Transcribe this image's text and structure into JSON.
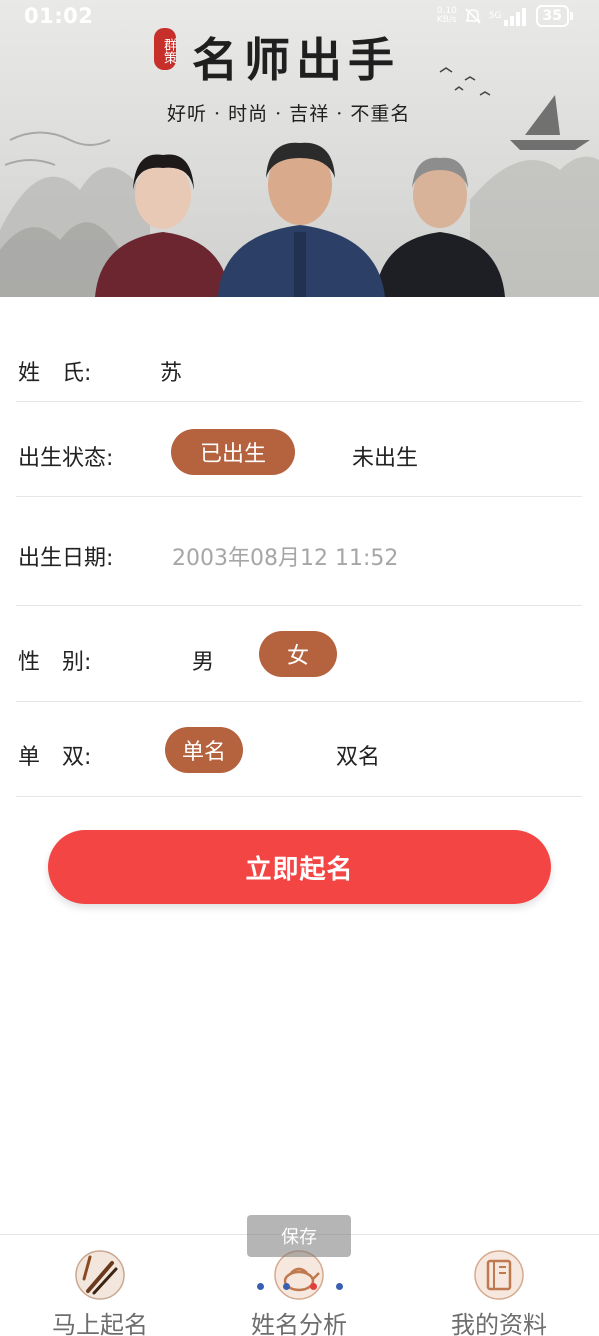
{
  "status_bar": {
    "time": "01:02",
    "net_speed_value": "0.10",
    "net_speed_unit": "KB/s",
    "network_type": "5G",
    "battery": "35"
  },
  "banner": {
    "seal_text": "群策",
    "title": "名师出手",
    "subtitle": "好听 · 时尚 · 吉祥 · 不重名"
  },
  "form": {
    "surname": {
      "label": "姓　氏:",
      "value": "苏"
    },
    "birth_status": {
      "label": "出生状态:",
      "options": [
        "已出生",
        "未出生"
      ],
      "selected": "已出生"
    },
    "birth_date": {
      "label": "出生日期:",
      "value": "2003年08月12 11:52"
    },
    "gender": {
      "label": "性　别:",
      "options": [
        "男",
        "女"
      ],
      "selected": "女"
    },
    "name_length": {
      "label": "单　双:",
      "options": [
        "单名",
        "双名"
      ],
      "selected": "单名"
    }
  },
  "submit_label": "立即起名",
  "toast": "保存",
  "bottom_nav": [
    {
      "label": "马上起名",
      "icon": "brush-icon"
    },
    {
      "label": "姓名分析",
      "icon": "teapot-icon"
    },
    {
      "label": "我的资料",
      "icon": "scroll-book-icon"
    }
  ],
  "colors": {
    "accent_pill": "#b5623f",
    "submit_button": "#f44545"
  }
}
